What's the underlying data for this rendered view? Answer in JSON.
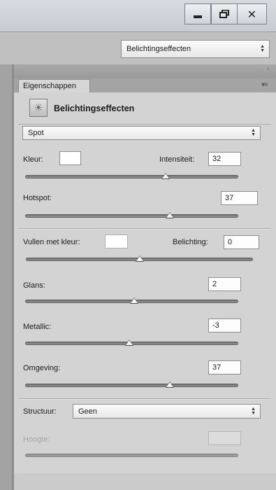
{
  "window": {
    "minimize_icon": "minimize-icon",
    "restore_icon": "restore-icon",
    "close_icon": "close-icon"
  },
  "options_bar": {
    "preset": "Belichtingseffecten"
  },
  "panel": {
    "tab_label": "Eigenschappen",
    "title": "Belichtingseffecten",
    "light_icon": "spotlight-icon",
    "light_type": "Spot",
    "color_label": "Kleur:",
    "color_value": "#ffffff",
    "intensity_label": "Intensiteit:",
    "intensity_value": "32",
    "hotspot_label": "Hotspot:",
    "hotspot_value": "37",
    "fill_color_label": "Vullen met kleur:",
    "fill_color_value": "#ffffff",
    "exposure_label": "Belichting:",
    "exposure_value": "0",
    "gloss_label": "Glans:",
    "gloss_value": "2",
    "metallic_label": "Metallic:",
    "metallic_value": "-3",
    "ambience_label": "Omgeving:",
    "ambience_value": "37",
    "texture_label": "Structuur:",
    "texture_value": "Geen",
    "height_label": "Hoogte:",
    "height_value": ""
  },
  "sliders": {
    "intensity": 0.66,
    "hotspot": 0.68,
    "exposure": 0.5,
    "gloss": 0.51,
    "metallic": 0.49,
    "ambience": 0.68
  }
}
